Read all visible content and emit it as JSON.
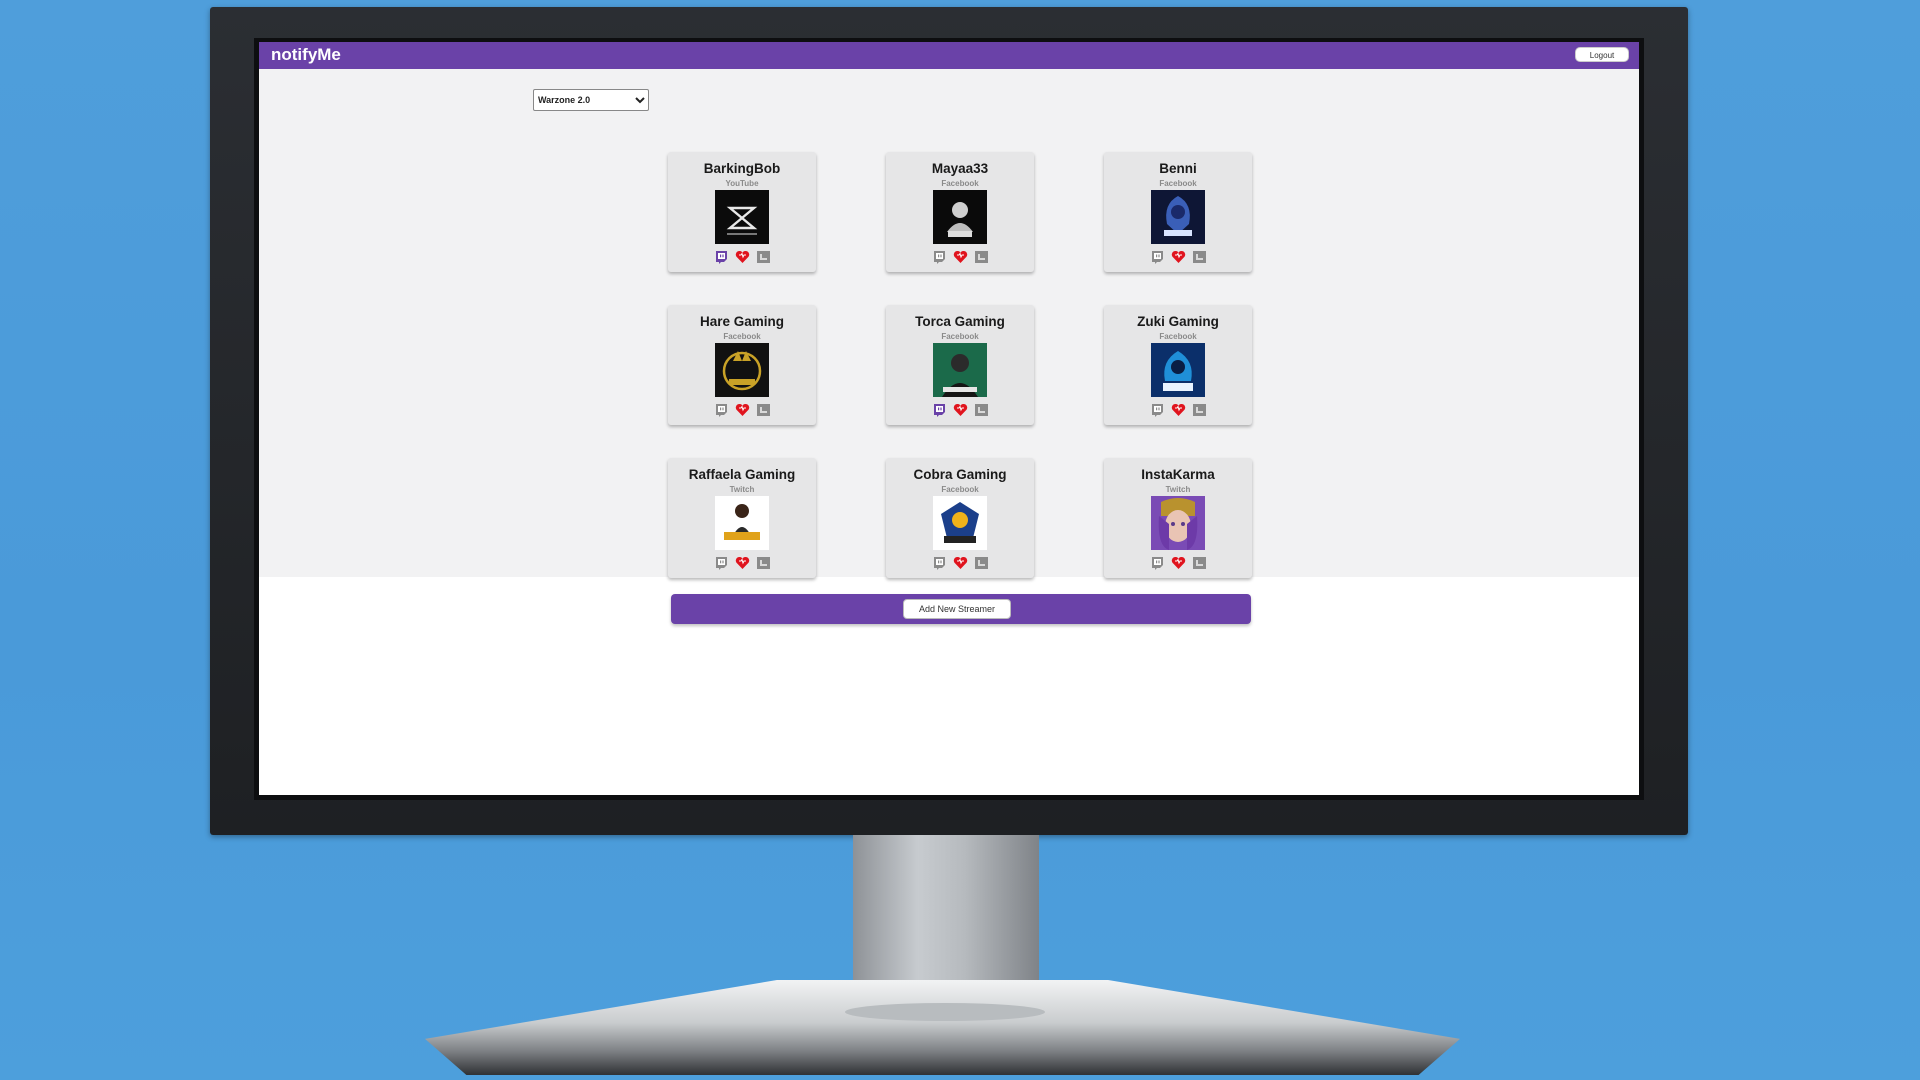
{
  "app": {
    "brand": "notifyMe",
    "logout_label": "Logout"
  },
  "filter": {
    "selected_game": "Warzone 2.0",
    "options": [
      "Warzone 2.0"
    ]
  },
  "streamers": [
    {
      "name": "BarkingBob",
      "platform": "YouTube",
      "twitch_active": true
    },
    {
      "name": "Mayaa33",
      "platform": "Facebook",
      "twitch_active": false
    },
    {
      "name": "Benni",
      "platform": "Facebook",
      "twitch_active": false
    },
    {
      "name": "Hare Gaming",
      "platform": "Facebook",
      "twitch_active": false
    },
    {
      "name": "Torca Gaming",
      "platform": "Facebook",
      "twitch_active": true
    },
    {
      "name": "Zuki Gaming",
      "platform": "Facebook",
      "twitch_active": false
    },
    {
      "name": "Raffaela Gaming",
      "platform": "Twitch",
      "twitch_active": false
    },
    {
      "name": "Cobra Gaming",
      "platform": "Facebook",
      "twitch_active": false
    },
    {
      "name": "InstaKarma",
      "platform": "Twitch",
      "twitch_active": false
    }
  ],
  "actions": {
    "add_streamer_label": "Add New Streamer"
  },
  "colors": {
    "accent": "#6a42a8",
    "heart": "#e0141e",
    "twitch_active": "#6a42a8",
    "icon_inactive": "#8a8a8a",
    "desktop_bg": "#4d9edb"
  }
}
